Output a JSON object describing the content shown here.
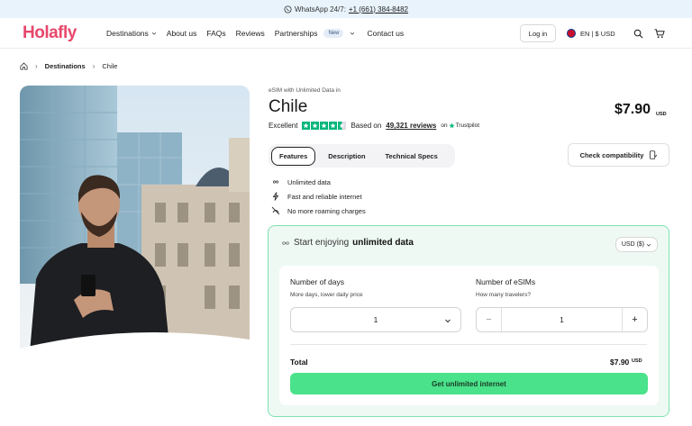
{
  "topbar": {
    "whatsapp_label": "WhatsApp 24/7:",
    "phone": "+1 (661) 384-8482",
    "icon": "whatsapp-icon"
  },
  "header": {
    "logo": "Holafly",
    "nav": [
      {
        "label": "Destinations",
        "has_chevron": true
      },
      {
        "label": "About us",
        "has_chevron": false
      },
      {
        "label": "FAQs",
        "has_chevron": false
      },
      {
        "label": "Reviews",
        "has_chevron": false
      },
      {
        "label": "Partnerships",
        "badge": "New",
        "has_chevron": true
      },
      {
        "label": "Contact us",
        "has_chevron": false
      }
    ],
    "login": "Log in",
    "locale": "EN | $ USD",
    "icons": [
      "uk-flag-icon",
      "search-icon",
      "cart-icon"
    ]
  },
  "breadcrumb": {
    "items": [
      "Destinations",
      "Chile"
    ]
  },
  "product": {
    "eyebrow": "eSIM with Unlimited Data in",
    "title": "Chile",
    "price": "$7.90",
    "price_currency": "USD",
    "rating_label": "Excellent",
    "stars": 4.5,
    "reviews_prefix": "Based on",
    "reviews_count": "49,321 reviews",
    "reviews_on": "on",
    "trustpilot": "Trustpilot"
  },
  "tabs": {
    "items": [
      "Features",
      "Description",
      "Technical Specs"
    ],
    "active": 0
  },
  "compat_button": "Check compatibility",
  "features": [
    {
      "label": "Unlimited data",
      "icon": "infinity-icon"
    },
    {
      "label": "Fast and reliable internet",
      "icon": "lightning-icon"
    },
    {
      "label": "No more roaming charges",
      "icon": "no-roaming-icon"
    }
  ],
  "offer": {
    "heading_prefix": "Start enjoying",
    "heading_bold": "unlimited data",
    "currency_select": "USD ($)",
    "days": {
      "label": "Number of days",
      "sub": "More days, lower daily price",
      "value": "1"
    },
    "esims": {
      "label": "Number of eSIMs",
      "sub": "How many travelers?",
      "value": "1",
      "minus": "−",
      "plus": "+"
    },
    "total_label": "Total",
    "total_value": "$7.90",
    "total_currency": "USD",
    "cta": "Get unlimited internet"
  },
  "colors": {
    "brand": "#e8476b",
    "cta": "#4ae28a",
    "trustpilot_green": "#00b67a",
    "offer_border": "#7ee2b0"
  }
}
